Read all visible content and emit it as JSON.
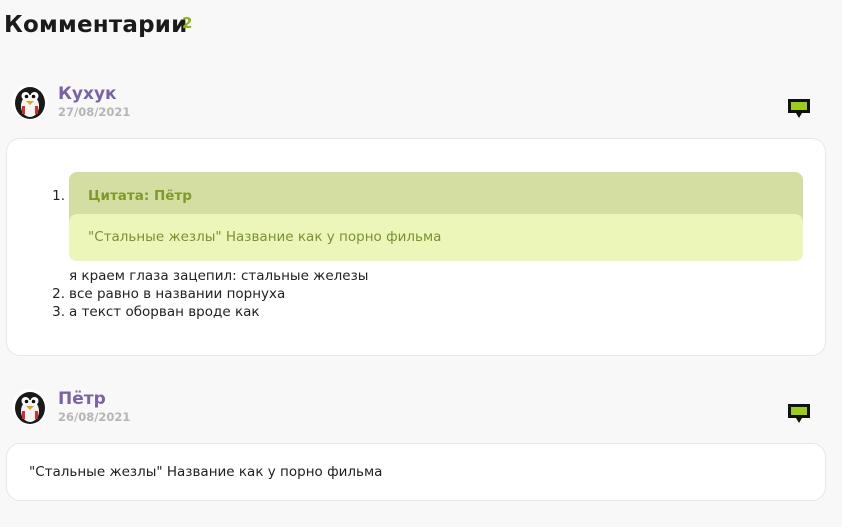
{
  "section": {
    "title": "Комментарии",
    "count": "2"
  },
  "comments": [
    {
      "author": "Кухук",
      "date": "27/08/2021",
      "avatar_icon": "penguin-avatar-icon",
      "reply_icon": "speech-bubble-icon",
      "items": [
        {
          "number": "1.",
          "quote": {
            "header": "Цитата: Пётр",
            "text": "\"Стальные жезлы\" Название как у порно фильма"
          },
          "text": "я краем глаза зацепил: стальные железы"
        },
        {
          "number": "2.",
          "text": "все равно в названии порнуха"
        },
        {
          "number": "3.",
          "text": "а текст оборван вроде как"
        }
      ]
    },
    {
      "author": "Пётр",
      "date": "26/08/2021",
      "avatar_icon": "penguin-avatar-icon",
      "reply_icon": "speech-bubble-icon",
      "text": "\"Стальные жезлы\" Название как у порно фильма"
    }
  ],
  "colors": {
    "accent_green": "#8db325",
    "author_purple": "#7b61a6",
    "quote_header_bg": "#d4dea3",
    "quote_body_bg": "#ebf6b8"
  }
}
